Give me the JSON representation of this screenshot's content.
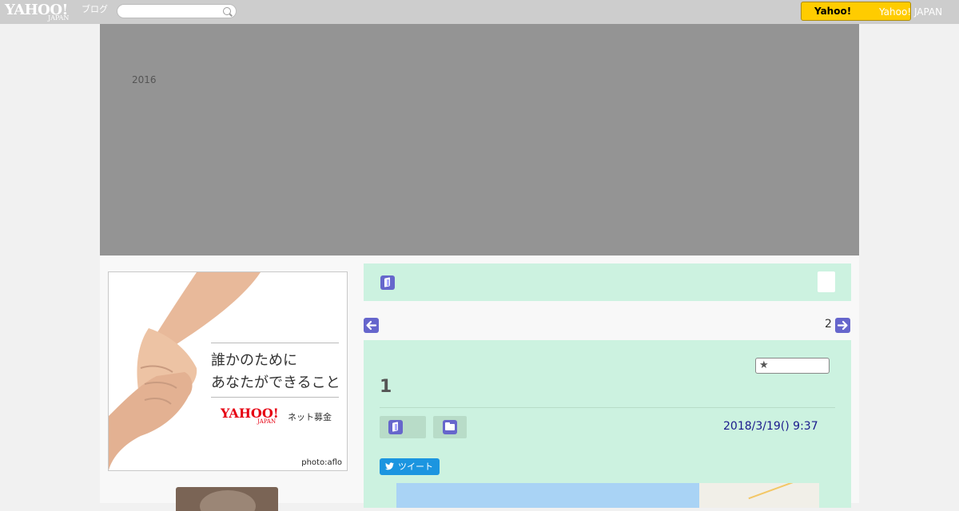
{
  "topbar": {
    "logo_text": "YAHOO!",
    "logo_sub": "JAPAN",
    "logo_blog": "ブログ",
    "search": {
      "value": "",
      "placeholder": ""
    },
    "yahoo_button_label": "Yahoo!",
    "yahoo_japan_link": "Yahoo! JAPAN"
  },
  "header": {
    "year": "2016"
  },
  "ad": {
    "line1": "誰かのために",
    "line2": "あなたができること",
    "brand": "YAHOO!",
    "brand_sub": "JAPAN",
    "service": "ネット募金",
    "credit": "photo:aflo"
  },
  "nav": {
    "next_number": "2"
  },
  "post": {
    "title": "1",
    "date": "2018/3/19()  9:37",
    "tweet_label": "ツイート"
  },
  "colors": {
    "topbar": "#cdcdcd",
    "header": "#949494",
    "panel": "#ccf2e0",
    "accent": "#6666cc",
    "yahoo_yellow": "#ffcc00",
    "tweet_blue": "#1b95e0"
  }
}
